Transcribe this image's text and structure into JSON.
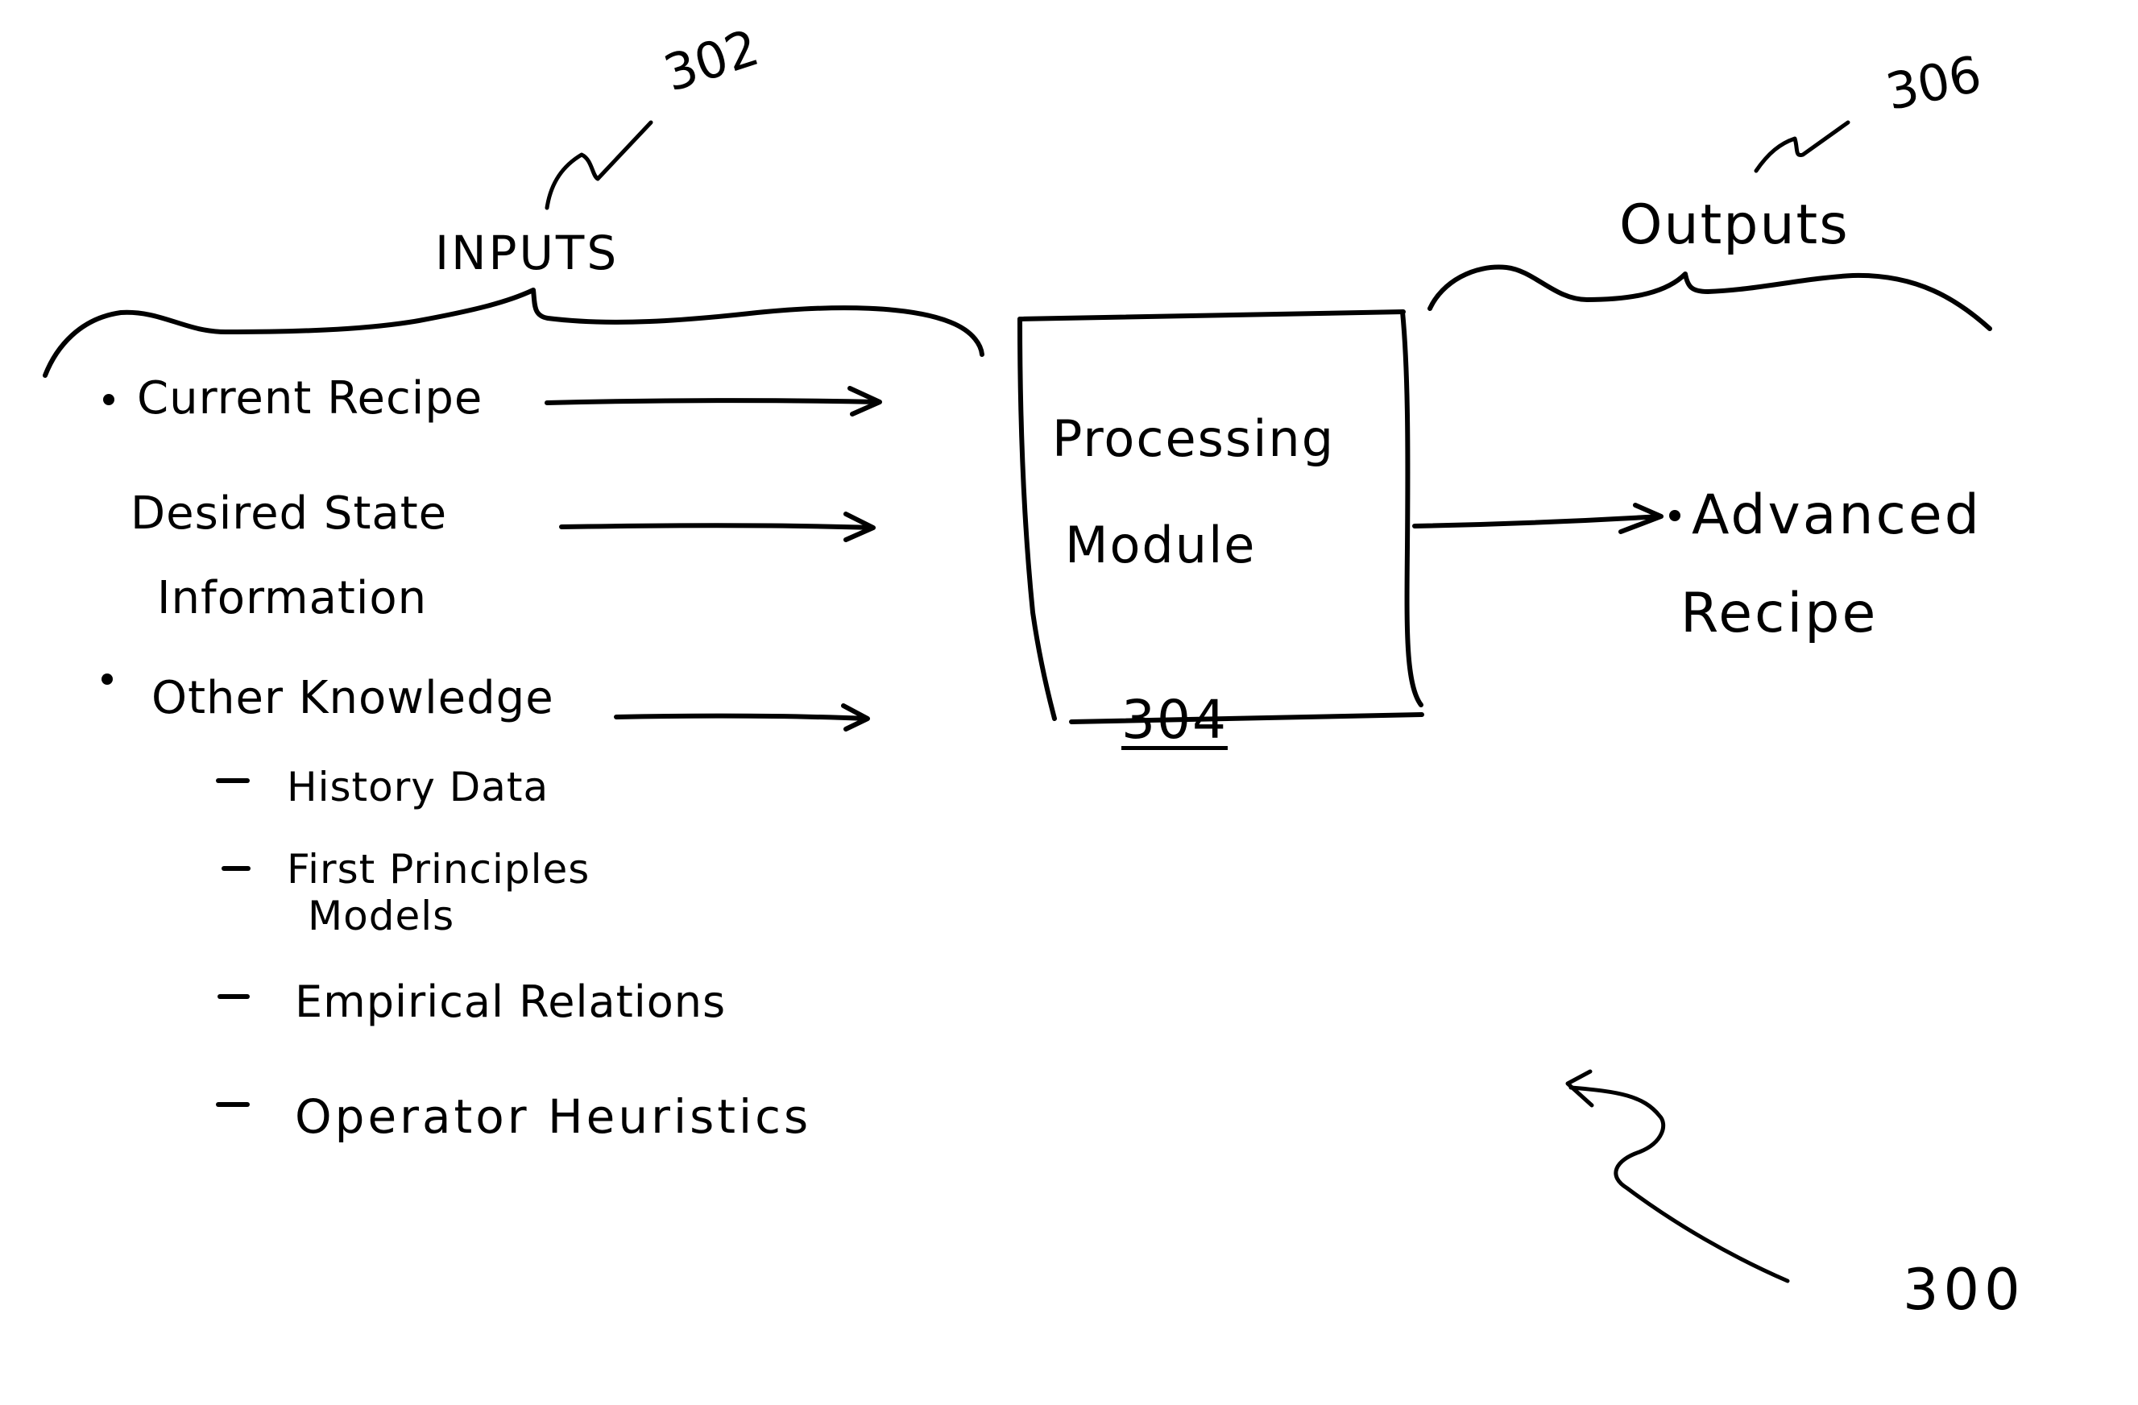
{
  "figure": {
    "reference_number": "300"
  },
  "inputs": {
    "reference_number": "302",
    "heading": "INPUTS",
    "items": [
      {
        "label": "Current Recipe",
        "bullet": true,
        "has_arrow": true
      },
      {
        "label_line1": "Desired State",
        "label_line2": "Information",
        "bullet": false,
        "has_arrow": true
      },
      {
        "label": "Other Knowledge",
        "bullet": true,
        "has_arrow": true,
        "subitems": [
          {
            "label": "History Data"
          },
          {
            "label_line1": "First Principles",
            "label_line2": "Models"
          },
          {
            "label": "Empirical Relations"
          },
          {
            "label": "Operator Heuristics"
          }
        ]
      }
    ]
  },
  "processing_module": {
    "title_line1": "Processing",
    "title_line2": "Module",
    "reference_number": "304"
  },
  "outputs": {
    "reference_number": "306",
    "heading": "Outputs",
    "items": [
      {
        "label_line1": "Advanced",
        "label_line2": "Recipe",
        "bullet": true
      }
    ]
  }
}
